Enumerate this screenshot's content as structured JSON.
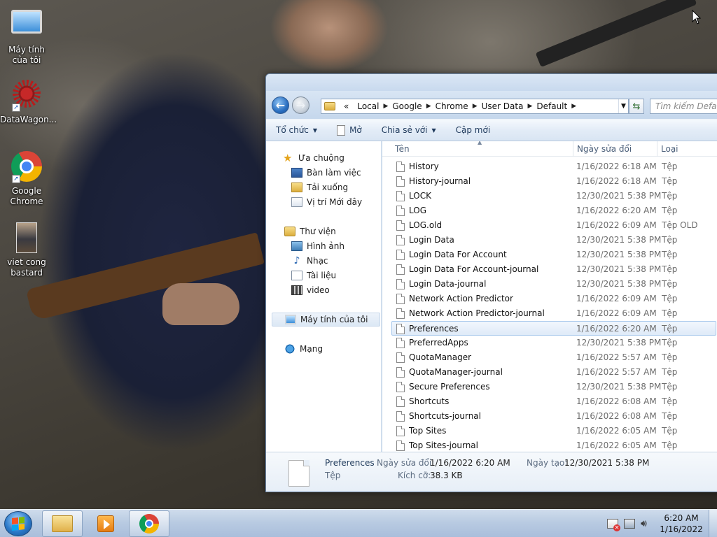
{
  "desktop": {
    "icons": [
      {
        "label": "Máy tính của tôi",
        "icon": "computer-icon"
      },
      {
        "label": "DataWagon...",
        "icon": "datawagon-icon"
      },
      {
        "label": "Google Chrome",
        "icon": "chrome-icon"
      },
      {
        "label": "viet cong bastard",
        "icon": "image-file-icon"
      }
    ]
  },
  "explorer": {
    "address": {
      "overflow": "«",
      "crumbs": [
        "Local",
        "Google",
        "Chrome",
        "User Data",
        "Default"
      ]
    },
    "search_placeholder": "Tìm kiếm Default",
    "toolbar": {
      "organize": "Tổ chức",
      "open": "Mở",
      "share": "Chia sẻ với",
      "burn": "Cập mới"
    },
    "nav": {
      "favorites": "Ưa chuộng",
      "desktop": "Bàn làm việc",
      "downloads": "Tải xuống",
      "recent": "Vị trí Mới đây",
      "libraries": "Thư viện",
      "pictures": "Hình ảnh",
      "music": "Nhạc",
      "documents": "Tài liệu",
      "videos": "video",
      "computer": "Máy tính của tôi",
      "network": "Mạng"
    },
    "columns": {
      "name": "Tên",
      "date": "Ngày sửa đổi",
      "type": "Loại"
    },
    "files": [
      {
        "name": "History",
        "date": "1/16/2022 6:18 AM",
        "type": "Tệp"
      },
      {
        "name": "History-journal",
        "date": "1/16/2022 6:18 AM",
        "type": "Tệp"
      },
      {
        "name": "LOCK",
        "date": "12/30/2021 5:38 PM",
        "type": "Tệp"
      },
      {
        "name": "LOG",
        "date": "1/16/2022 6:20 AM",
        "type": "Tệp"
      },
      {
        "name": "LOG.old",
        "date": "1/16/2022 6:09 AM",
        "type": "Tệp OLD"
      },
      {
        "name": "Login Data",
        "date": "12/30/2021 5:38 PM",
        "type": "Tệp"
      },
      {
        "name": "Login Data For Account",
        "date": "12/30/2021 5:38 PM",
        "type": "Tệp"
      },
      {
        "name": "Login Data For Account-journal",
        "date": "12/30/2021 5:38 PM",
        "type": "Tệp"
      },
      {
        "name": "Login Data-journal",
        "date": "12/30/2021 5:38 PM",
        "type": "Tệp"
      },
      {
        "name": "Network Action Predictor",
        "date": "1/16/2022 6:09 AM",
        "type": "Tệp"
      },
      {
        "name": "Network Action Predictor-journal",
        "date": "1/16/2022 6:09 AM",
        "type": "Tệp"
      },
      {
        "name": "Preferences",
        "date": "1/16/2022 6:20 AM",
        "type": "Tệp",
        "selected": true
      },
      {
        "name": "PreferredApps",
        "date": "12/30/2021 5:38 PM",
        "type": "Tệp"
      },
      {
        "name": "QuotaManager",
        "date": "1/16/2022 5:57 AM",
        "type": "Tệp"
      },
      {
        "name": "QuotaManager-journal",
        "date": "1/16/2022 5:57 AM",
        "type": "Tệp"
      },
      {
        "name": "Secure Preferences",
        "date": "12/30/2021 5:38 PM",
        "type": "Tệp"
      },
      {
        "name": "Shortcuts",
        "date": "1/16/2022 6:08 AM",
        "type": "Tệp"
      },
      {
        "name": "Shortcuts-journal",
        "date": "1/16/2022 6:08 AM",
        "type": "Tệp"
      },
      {
        "name": "Top Sites",
        "date": "1/16/2022 6:05 AM",
        "type": "Tệp"
      },
      {
        "name": "Top Sites-journal",
        "date": "1/16/2022 6:05 AM",
        "type": "Tệp"
      }
    ],
    "details": {
      "name": "Preferences",
      "kind": "Tệp",
      "modified_label": "Ngày sửa đổi:",
      "modified_value": "1/16/2022 6:20 AM",
      "size_label": "Kích cỡ:",
      "size_value": "38.3 KB",
      "created_label": "Ngày tạo:",
      "created_value": "12/30/2021 5:38 PM"
    }
  },
  "taskbar": {
    "tasks": [
      "explorer-icon",
      "media-player-icon",
      "chrome-icon"
    ],
    "clock": {
      "time": "6:20 AM",
      "date": "1/16/2022"
    }
  }
}
